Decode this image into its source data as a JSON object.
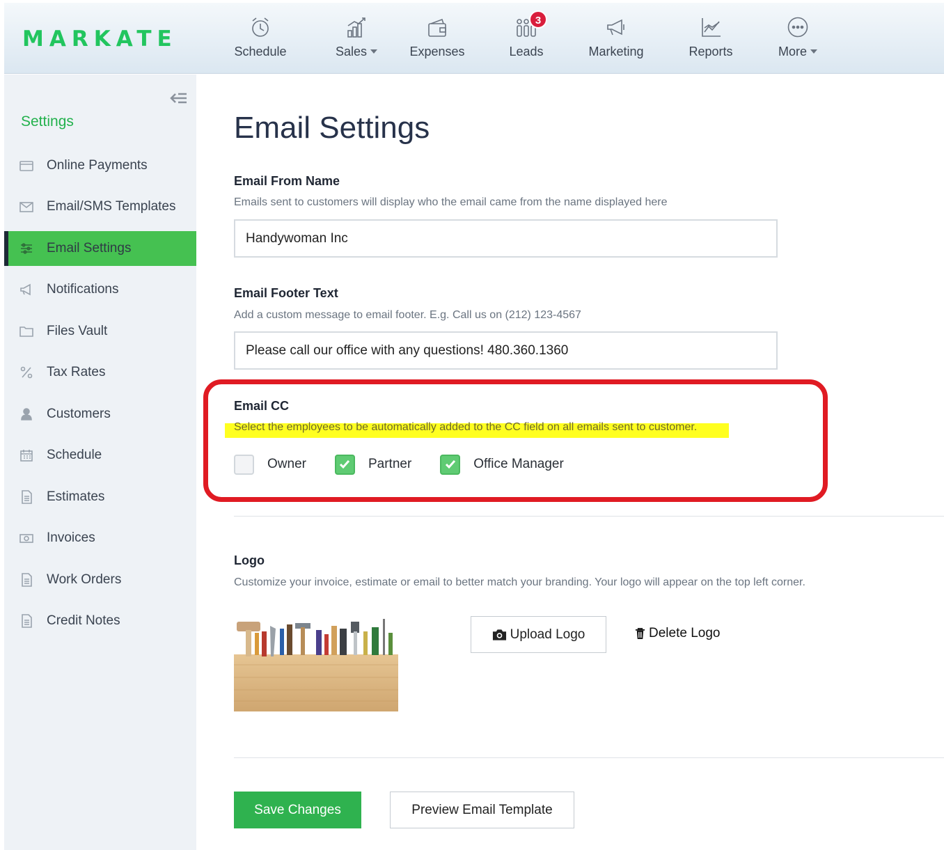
{
  "brand": {
    "logo_text": "MARKATE",
    "accent": "#22c55e"
  },
  "nav": {
    "items": [
      {
        "label": "Schedule",
        "icon": "alarm-clock-icon"
      },
      {
        "label": "Sales",
        "icon": "bar-chart-icon",
        "dropdown": true
      },
      {
        "label": "Expenses",
        "icon": "wallet-icon"
      },
      {
        "label": "Leads",
        "icon": "people-icon",
        "badge": "3"
      },
      {
        "label": "Marketing",
        "icon": "megaphone-icon"
      },
      {
        "label": "Reports",
        "icon": "line-chart-icon"
      },
      {
        "label": "More",
        "icon": "more-dots-icon",
        "dropdown": true
      }
    ]
  },
  "sidebar": {
    "title": "Settings",
    "items": [
      {
        "label": "Online Payments",
        "icon": "credit-card-icon"
      },
      {
        "label": "Email/SMS Templates",
        "icon": "envelope-icon"
      },
      {
        "label": "Email Settings",
        "icon": "sliders-icon",
        "active": true
      },
      {
        "label": "Notifications",
        "icon": "megaphone-icon"
      },
      {
        "label": "Files Vault",
        "icon": "folder-icon"
      },
      {
        "label": "Tax Rates",
        "icon": "percent-icon"
      },
      {
        "label": "Customers",
        "icon": "user-icon"
      },
      {
        "label": "Schedule",
        "icon": "calendar-icon"
      },
      {
        "label": "Estimates",
        "icon": "document-icon"
      },
      {
        "label": "Invoices",
        "icon": "money-icon"
      },
      {
        "label": "Work Orders",
        "icon": "document-icon"
      },
      {
        "label": "Credit Notes",
        "icon": "document-icon"
      }
    ]
  },
  "main": {
    "title": "Email Settings",
    "from_name": {
      "label": "Email From Name",
      "help": "Emails sent to customers will display who the email came from the name displayed here",
      "value": "Handywoman Inc"
    },
    "footer_text": {
      "label": "Email Footer Text",
      "help": "Add a custom message to email footer. E.g. Call us on (212) 123-4567",
      "value": "Please call our office with any questions! 480.360.1360"
    },
    "email_cc": {
      "label": "Email CC",
      "help": "Select the employees to be automatically added to the CC field on all emails sent to customer.",
      "options": [
        {
          "label": "Owner",
          "checked": false
        },
        {
          "label": "Partner",
          "checked": true
        },
        {
          "label": "Office Manager",
          "checked": true
        }
      ]
    },
    "logo": {
      "label": "Logo",
      "help": "Customize your invoice, estimate or email to better match your branding. Your logo will appear on the top left corner.",
      "upload_label": "Upload Logo",
      "delete_label": "Delete Logo"
    },
    "actions": {
      "save_label": "Save Changes",
      "preview_label": "Preview Email Template"
    }
  }
}
